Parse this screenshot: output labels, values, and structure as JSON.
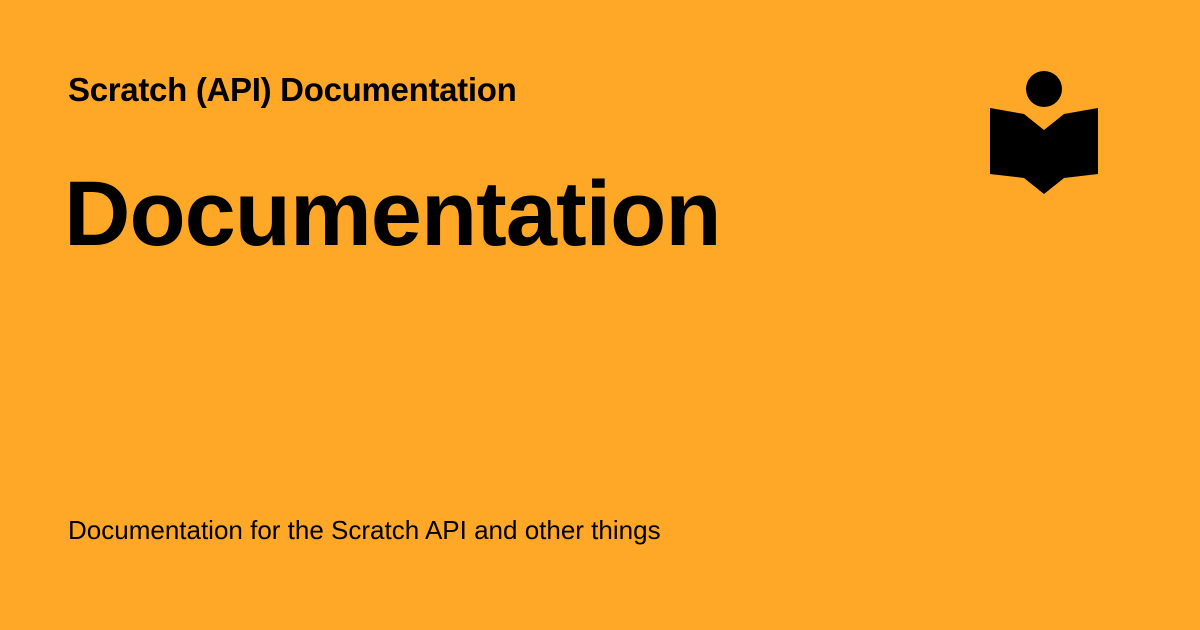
{
  "site": {
    "name": "Scratch (API) Documentation",
    "logo_icon": "reader-book-icon"
  },
  "page": {
    "title": "Documentation",
    "description": "Documentation for the Scratch API and other things"
  },
  "colors": {
    "background": "#FFA726",
    "text": "#000000"
  }
}
